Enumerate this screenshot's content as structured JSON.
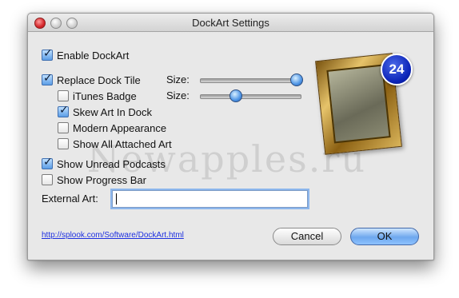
{
  "window": {
    "title": "DockArt Settings"
  },
  "options": {
    "enable_dockart": {
      "label": "Enable DockArt",
      "checked": true
    },
    "replace_dock_tile": {
      "label": "Replace Dock Tile",
      "checked": true
    },
    "itunes_badge": {
      "label": "iTunes Badge",
      "checked": false
    },
    "skew_art": {
      "label": "Skew Art In Dock",
      "checked": true
    },
    "modern_appearance": {
      "label": "Modern Appearance",
      "checked": false
    },
    "show_all_attached": {
      "label": "Show All Attached Art",
      "checked": false
    },
    "show_unread_podcasts": {
      "label": "Show Unread Podcasts",
      "checked": true
    },
    "show_progress_bar": {
      "label": "Show Progress Bar",
      "checked": false
    }
  },
  "sliders": {
    "dock_tile_size": {
      "label": "Size:",
      "value": 1.0
    },
    "itunes_badge_size": {
      "label": "Size:",
      "value": 0.33
    }
  },
  "external_art": {
    "label": "External Art:",
    "value": ""
  },
  "link": {
    "text": "http://splook.com/Software/DockArt.html"
  },
  "buttons": {
    "cancel": "Cancel",
    "ok": "OK"
  },
  "preview": {
    "badge_count": "24"
  },
  "watermark": "Newapples.ru",
  "colors": {
    "accent": "#5b9de6",
    "link": "#1d2fe0"
  }
}
